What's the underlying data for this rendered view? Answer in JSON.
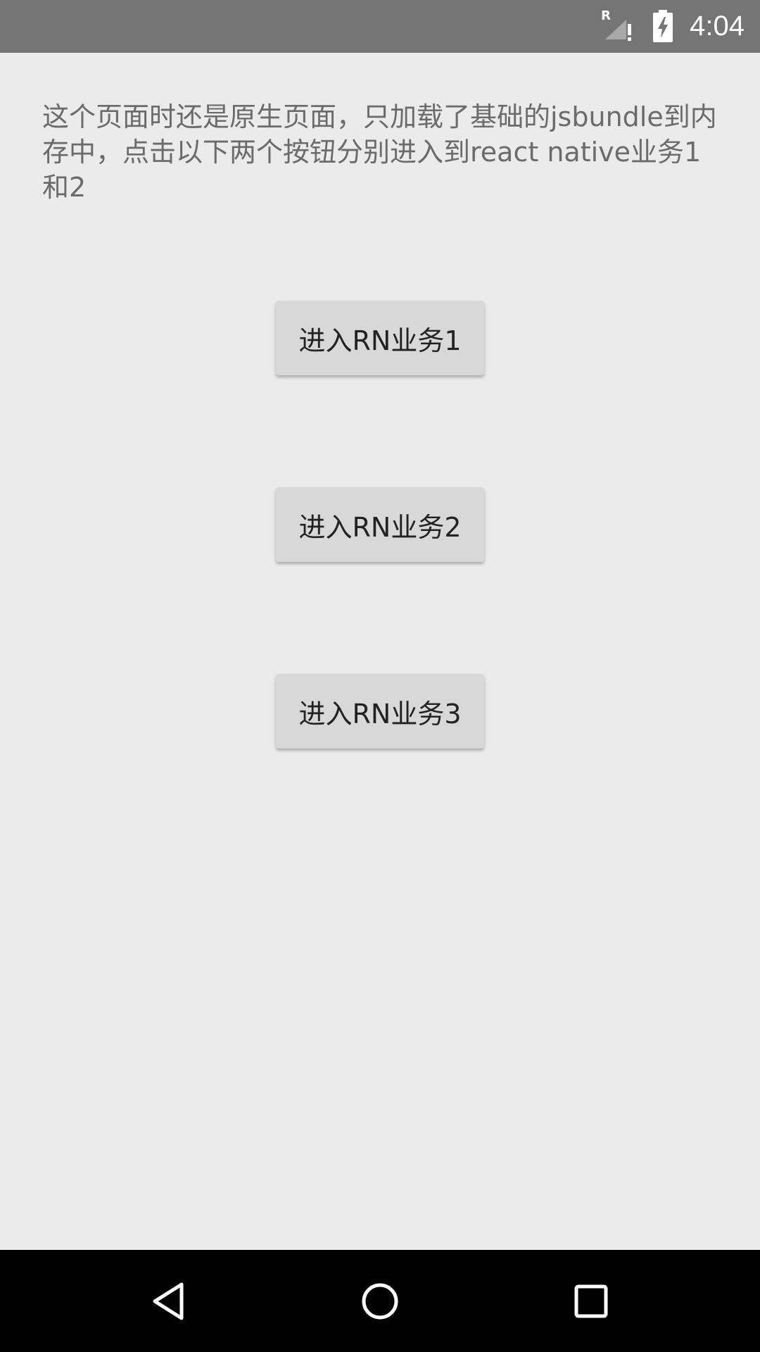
{
  "status_bar": {
    "time": "4:04",
    "signal_label": "R",
    "icons": [
      "signal-roaming-icon",
      "battery-charging-icon"
    ]
  },
  "main": {
    "intro_text": "这个页面时还是原生页面，只加载了基础的jsbundle到内存中，点击以下两个按钮分别进入到react native业务1和2",
    "buttons": [
      {
        "label": "进入RN业务1"
      },
      {
        "label": "进入RN业务2"
      },
      {
        "label": "进入RN业务3"
      }
    ]
  },
  "nav_bar": {
    "icons": [
      "back-icon",
      "home-icon",
      "recents-icon"
    ]
  },
  "colors": {
    "status_bar_bg": "#757575",
    "background": "#ebebeb",
    "button_bg": "#d8d8d8",
    "text": "#6b6b6b",
    "nav_bar_bg": "#000000"
  }
}
